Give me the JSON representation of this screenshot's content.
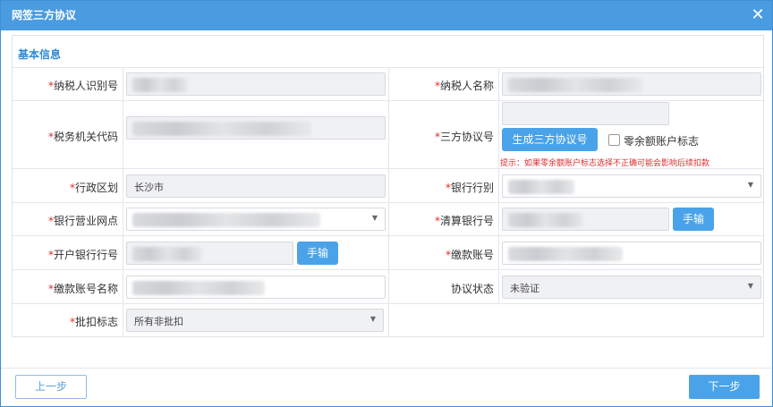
{
  "dialog": {
    "title": "网签三方协议",
    "close_glyph": "✕"
  },
  "section": {
    "title": "基本信息"
  },
  "required_mark": "*",
  "fields": {
    "taxpayer_id": {
      "label": "纳税人识别号"
    },
    "taxpayer_name": {
      "label": "纳税人名称"
    },
    "tax_office_code": {
      "label": "税务机关代码"
    },
    "tripartite_no": {
      "label": "三方协议号",
      "generate_button": "生成三方协议号",
      "zero_balance_label": "零余额账户标志",
      "hint": "提示：如果零余额账户标志选择不正确可能会影响后续扣款"
    },
    "admin_region": {
      "label": "行政区划",
      "value": "长沙市"
    },
    "bank_category": {
      "label": "银行行别"
    },
    "bank_branch": {
      "label": "银行营业网点"
    },
    "clearing_bank_no": {
      "label": "清算银行号",
      "manual_button": "手输"
    },
    "opening_bank_no": {
      "label": "开户银行行号",
      "manual_button": "手输"
    },
    "payment_account": {
      "label": "缴款账号"
    },
    "payment_account_name": {
      "label": "缴款账号名称"
    },
    "agreement_status": {
      "label": "协议状态",
      "value": "未验证"
    },
    "batch_deduct": {
      "label": "批扣标志",
      "value": "所有非批扣"
    }
  },
  "footer": {
    "prev_label": "上一步",
    "next_label": "下一步"
  },
  "colors": {
    "titlebar": "#4a9be0",
    "accent": "#4aa3e8",
    "required": "#e02b2b",
    "section_title": "#2f8ad4"
  }
}
